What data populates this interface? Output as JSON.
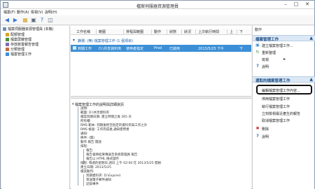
{
  "window": {
    "title": "檔案伺服器資源管理員"
  },
  "menu": [
    "檔案(F)",
    "動作(A)",
    "檢視(V)",
    "說明(H)"
  ],
  "toolbar": {
    "icons": [
      "back-icon",
      "forward-icon",
      "folder-icon",
      "properties-icon",
      "help-icon",
      "panel-icon"
    ]
  },
  "tree": {
    "items": [
      {
        "label": "檔案伺服器資源管理員 (本機)",
        "icon": "server-icon"
      },
      {
        "label": "配額管理",
        "icon": "quota-icon"
      },
      {
        "label": "檔案屏蔽管理",
        "icon": "screen-icon"
      },
      {
        "label": "存放裝置報告管理",
        "icon": "report-icon"
      },
      {
        "label": "分類管理",
        "icon": "classification-icon"
      },
      {
        "label": "檔案管理工作",
        "icon": "task-icon"
      }
    ]
  },
  "list": {
    "columns": [
      "工作名稱",
      "範圍",
      "排程與範圍",
      "動作",
      "狀態",
      "狀況",
      "上次執行時間",
      "上",
      "下"
    ],
    "note": "篩選: (無) 檔案管理工作 (1 個項目)",
    "row": {
      "name": "到期工作",
      "scope": "D:\\共享資料夾",
      "schedule": "使用者指定",
      "action": "Prod",
      "status": "已啟用",
      "last_run": "2013/5/25 下午",
      "next": "下"
    }
  },
  "detail": {
    "title": "檔案管理工作的說明與詳細資訊",
    "lines": [
      "說明:",
      "範圍: D:\\共享資料夾",
      "檔案到期日期: 建立時間之後 365 天",
      "所有權:",
      "RMS 範本: 到期後移至指定的資料夾與工作之外",
      "RMS 檢查: 工作完成後,通知使用者",
      "通知:",
      "條件: (無)",
      "動作 報告 開啟",
      "排程:",
      "報告:",
      "報告會將結果傳送至系統管理員 報告",
      "報告以 HTML 格式儲存",
      "排程: 每週的星期日,週日 上午 02:00 在 2013/5/25 開始",
      "建立日期: 2013/5/25",
      "檔案動作:",
      "到期資料夾: D:\\Expired",
      "寄送電子郵件通知",
      "記錄事件"
    ]
  },
  "actions": {
    "header": "動作",
    "group1": {
      "label": "檔案管理工作",
      "items": [
        {
          "label": "建立檔案管理工作...",
          "icon": "create-icon"
        },
        {
          "label": "重新整理",
          "icon": "refresh-icon"
        },
        {
          "label": "檢視",
          "icon": "view-icon"
        },
        {
          "label": "說明",
          "icon": "help-icon"
        }
      ]
    },
    "group2": {
      "label": "選取的檔案管理工作",
      "items": [
        {
          "label": "編輯檔案管理工作內容...",
          "icon": "edit-icon"
        },
        {
          "label": "停用檔案管理工作",
          "icon": "disable-icon"
        },
        {
          "label": "執行檔案管理工作",
          "icon": "run-icon"
        },
        {
          "label": "立刻檢視最近產生的報告",
          "icon": "report-icon"
        },
        {
          "label": "取消檔案管理工作",
          "icon": "cancel-icon"
        },
        {
          "label": "刪除",
          "icon": "delete-icon"
        },
        {
          "label": "說明",
          "icon": "help-icon"
        }
      ]
    }
  },
  "colors": {
    "accent": "#3b8fd6",
    "group_bg": "#dce8f5",
    "delete": "#c82020"
  }
}
